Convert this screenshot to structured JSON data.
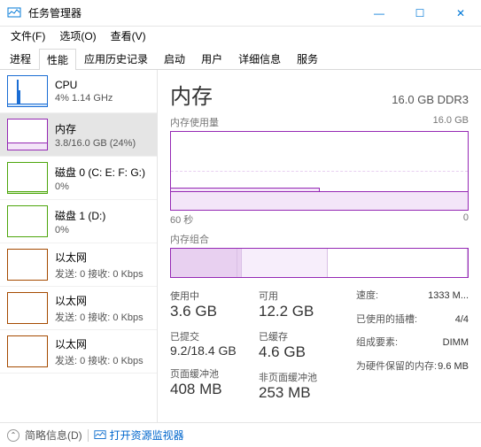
{
  "window": {
    "title": "任务管理器",
    "minimize": "—",
    "maximize": "☐",
    "close": "✕"
  },
  "menu": {
    "file": "文件(F)",
    "options": "选项(O)",
    "view": "查看(V)"
  },
  "tabs": {
    "processes": "进程",
    "performance": "性能",
    "app_history": "应用历史记录",
    "startup": "启动",
    "users": "用户",
    "details": "详细信息",
    "services": "服务"
  },
  "sidebar": [
    {
      "title": "CPU",
      "sub": "4%  1.14 GHz",
      "type": "cpu"
    },
    {
      "title": "内存",
      "sub": "3.8/16.0 GB (24%)",
      "type": "mem"
    },
    {
      "title": "磁盘 0 (C: E: F: G:)",
      "sub": "0%",
      "type": "disk"
    },
    {
      "title": "磁盘 1 (D:)",
      "sub": "0%",
      "type": "disk"
    },
    {
      "title": "以太网",
      "sub": "发送: 0 接收: 0 Kbps",
      "type": "net"
    },
    {
      "title": "以太网",
      "sub": "发送: 0 接收: 0 Kbps",
      "type": "net"
    },
    {
      "title": "以太网",
      "sub": "发送: 0 接收: 0 Kbps",
      "type": "net"
    }
  ],
  "main": {
    "title": "内存",
    "spec": "16.0 GB DDR3",
    "usage_label": "内存使用量",
    "usage_max": "16.0 GB",
    "time_start": "60 秒",
    "time_end": "0",
    "composition_label": "内存组合",
    "stats": {
      "in_use_label": "使用中",
      "in_use": "3.6 GB",
      "available_label": "可用",
      "available": "12.2 GB",
      "committed_label": "已提交",
      "committed": "9.2/18.4 GB",
      "cached_label": "已缓存",
      "cached": "4.6 GB",
      "paged_label": "页面缓冲池",
      "paged": "408 MB",
      "nonpaged_label": "非页面缓冲池",
      "nonpaged": "253 MB"
    },
    "info": {
      "speed_label": "速度:",
      "speed": "1333 M...",
      "slots_label": "已使用的插槽:",
      "slots": "4/4",
      "form_label": "组成要素:",
      "form": "DIMM",
      "reserved_label": "为硬件保留的内存:",
      "reserved": "9.6 MB"
    }
  },
  "footer": {
    "fewer": "简略信息(D)",
    "monitor": "打开资源监视器"
  },
  "chart_data": {
    "type": "area",
    "title": "内存使用量",
    "xlabel": "秒",
    "ylabel": "GB",
    "x_range": [
      60,
      0
    ],
    "ylim": [
      0,
      16.0
    ],
    "series": [
      {
        "name": "内存使用量 (GB)",
        "values": [
          4.0,
          4.0,
          4.0,
          4.0,
          4.0,
          4.0,
          3.8,
          3.8,
          3.8,
          3.8,
          3.8,
          3.8,
          3.8
        ]
      }
    ],
    "composition_gb": {
      "in_use": 3.6,
      "modified": 0.2,
      "standby": 4.6,
      "free": 7.6,
      "total": 16.0
    }
  }
}
